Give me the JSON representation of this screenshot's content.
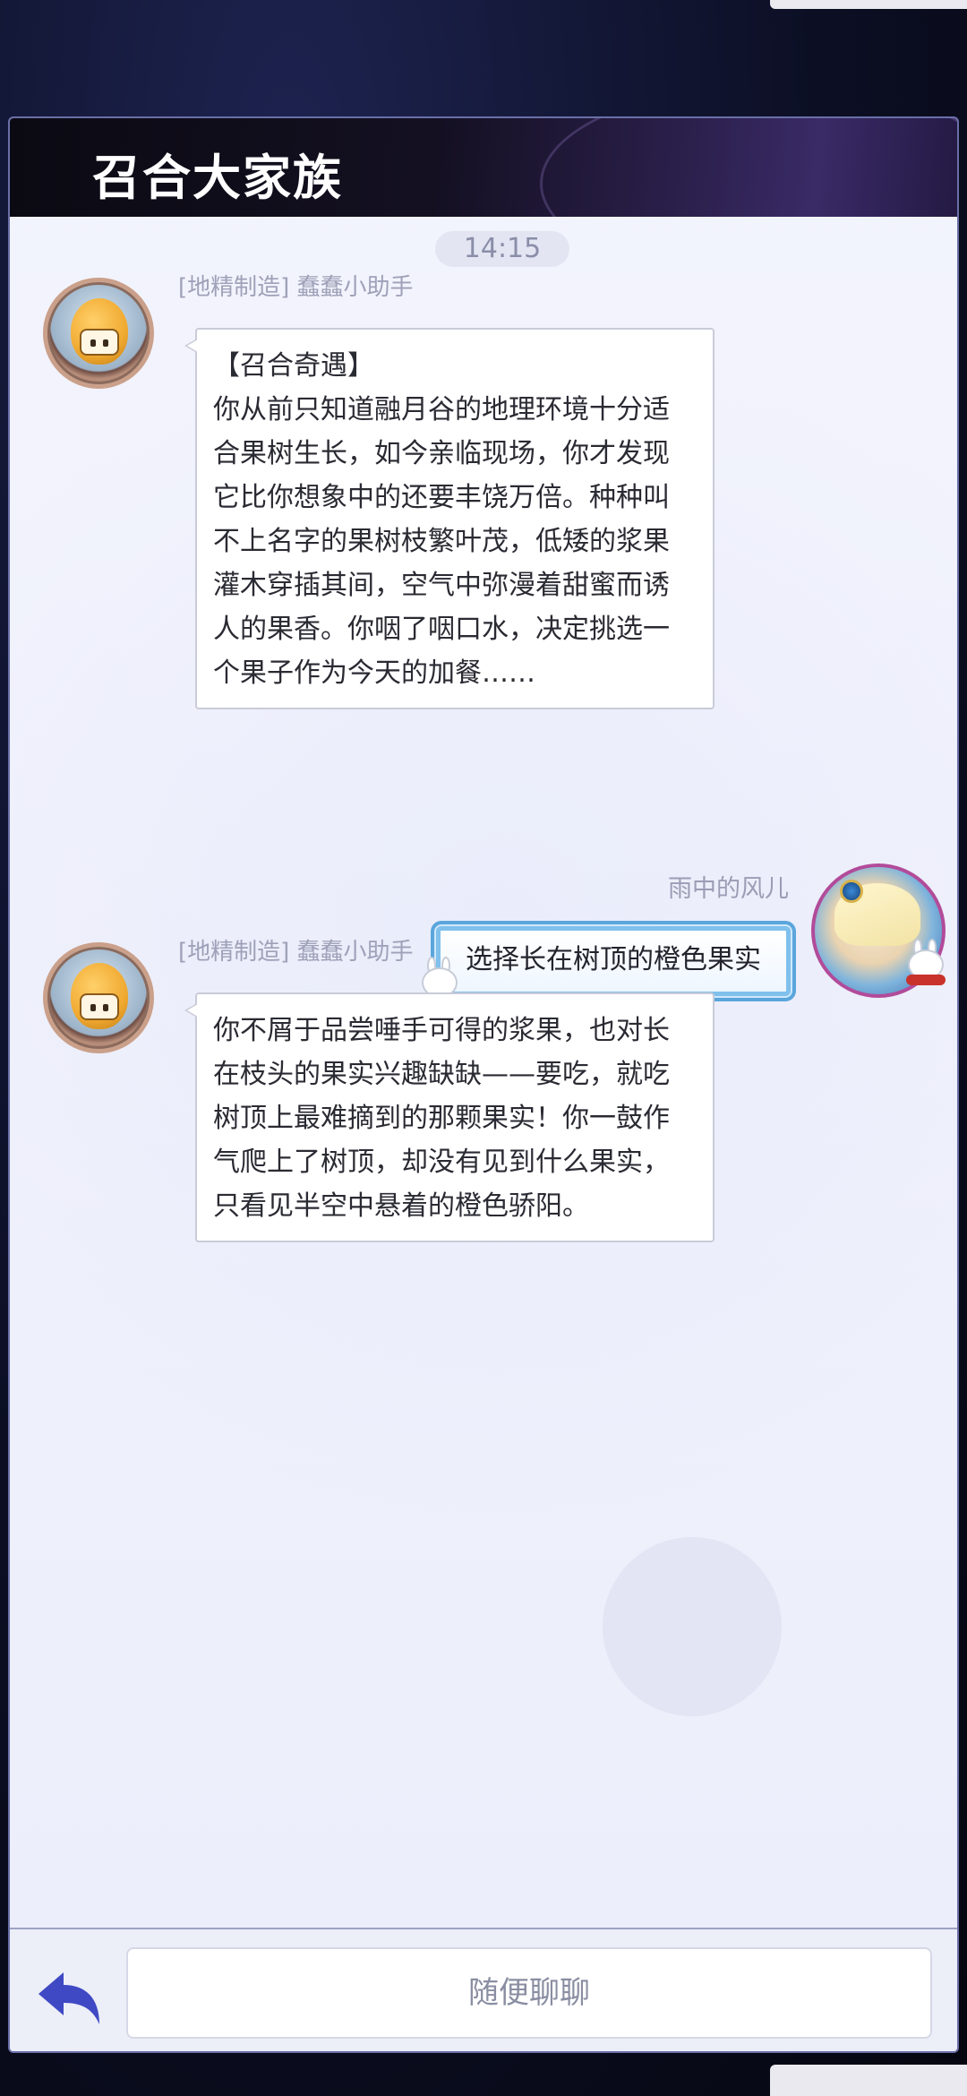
{
  "header": {
    "title": "召合大家族"
  },
  "chat": {
    "timestamp": "14:15",
    "messages": [
      {
        "sender": "[地精制造] 蠢蠢小助手",
        "text": "【召合奇遇】\n你从前只知道融月谷的地理环境十分适\n合果树生长，如今亲临现场，你才发现\n它比你想象中的还要丰饶万倍。种种叫\n不上名字的果树枝繁叶茂，低矮的浆果\n灌木穿插其间，空气中弥漫着甜蜜而诱\n人的果香。你咽了咽口水，决定挑选一\n个果子作为今天的加餐……"
      },
      {
        "sender": "雨中的风儿",
        "text": "选择长在树顶的橙色果实"
      },
      {
        "sender": "[地精制造] 蠢蠢小助手",
        "text": "你不屑于品尝唾手可得的浆果，也对长\n在枝头的果实兴趣缺缺——要吃，就吃\n树顶上最难摘到的那颗果实！你一鼓作\n气爬上了树顶，却没有见到什么果实，\n只看见半空中悬着的橙色骄阳。"
      }
    ]
  },
  "footer": {
    "input_placeholder": "随便聊聊",
    "back_icon": "back-arrow-icon"
  },
  "colors": {
    "accent": "#3f49c4",
    "panel_bg": "#f1f2fb",
    "header_bg": "#0b0a12"
  }
}
